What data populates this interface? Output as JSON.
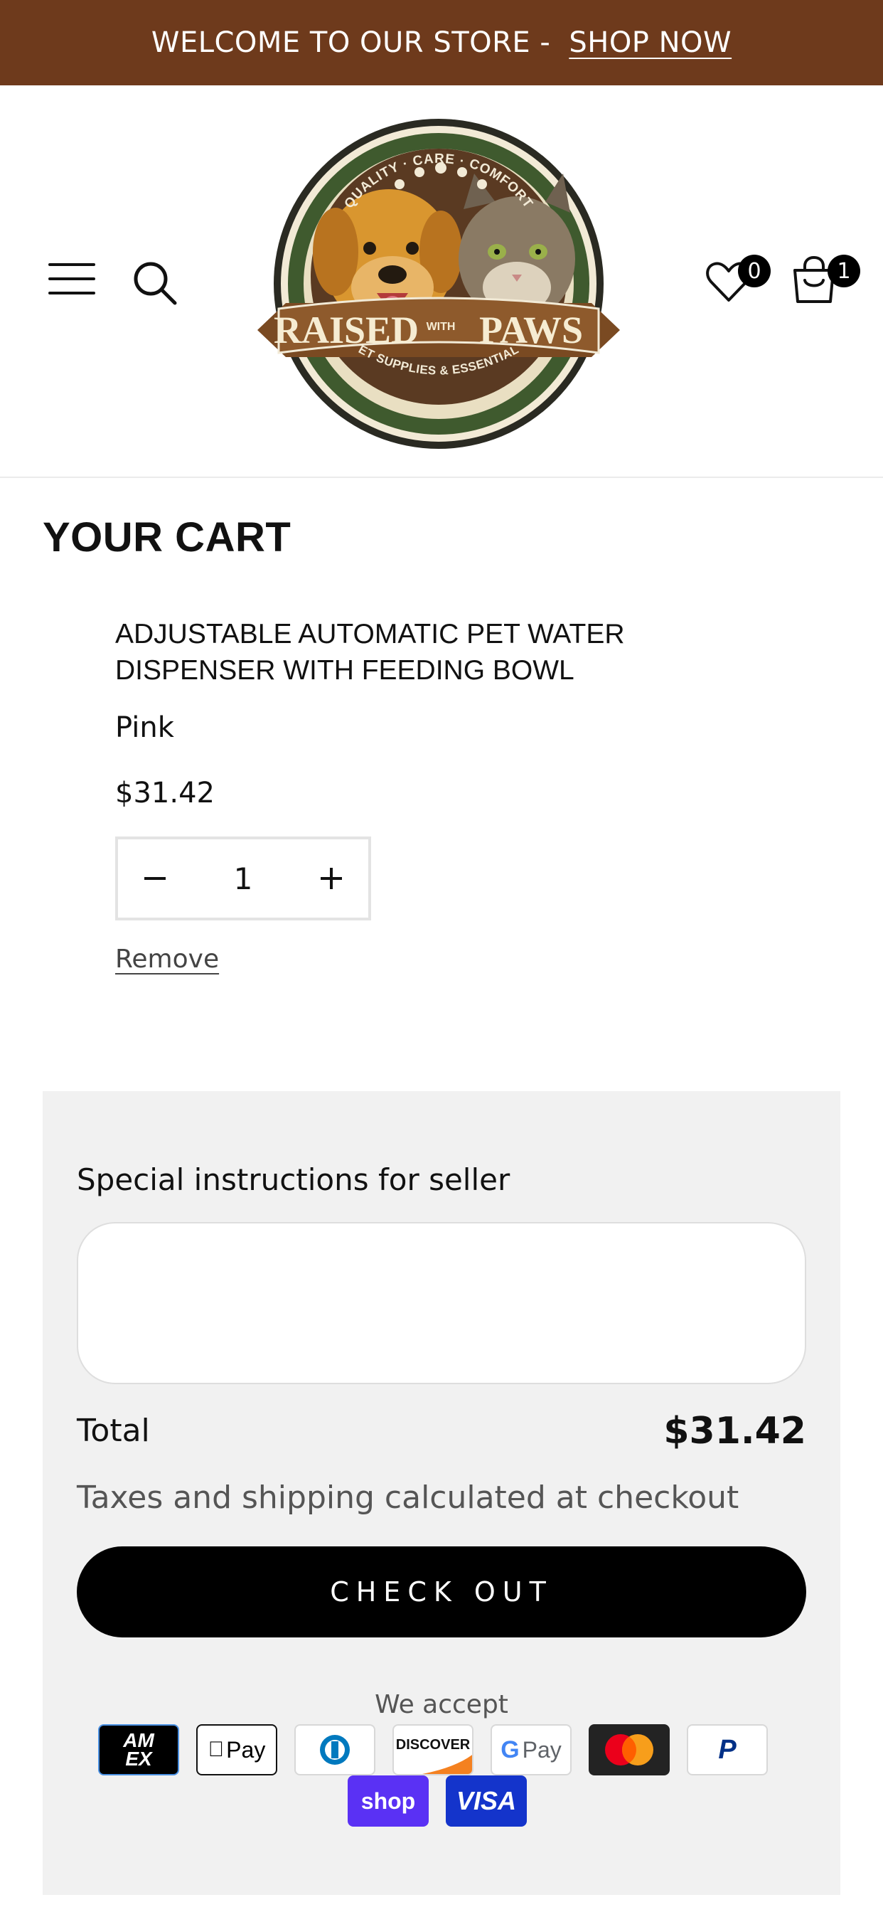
{
  "announcement": {
    "text": "WELCOME TO OUR STORE -",
    "link": "SHOP NOW"
  },
  "header": {
    "logo_text": {
      "top": "QUALITY · CARE · COMFORT",
      "brand_left": "RAISED",
      "brand_mid": "WITH",
      "brand_right": "PAWS",
      "bottom": "PET SUPPLIES & ESSENTIALS"
    },
    "wishlist_count": "0",
    "cart_count": "1"
  },
  "cart": {
    "title": "YOUR CART",
    "item": {
      "title": "ADJUSTABLE AUTOMATIC PET WATER DISPENSER WITH FEEDING BOWL",
      "variant": "Pink",
      "price": "$31.42",
      "quantity": "1",
      "remove_label": "Remove"
    }
  },
  "summary": {
    "instructions_label": "Special instructions for seller",
    "instructions_value": "",
    "total_label": "Total",
    "total_value": "$31.42",
    "tax_note": "Taxes and shipping calculated at checkout",
    "checkout_label": "CHECK OUT",
    "accept_label": "We accept",
    "payment_methods": [
      "American Express",
      "Apple Pay",
      "Diners Club",
      "Discover",
      "Google Pay",
      "Mastercard",
      "PayPal",
      "Shop Pay",
      "Visa"
    ],
    "payment_labels": {
      "amex_top": "AM",
      "amex_bottom": "EX",
      "applepay": "Pay",
      "discover": "DISCOVER",
      "gpay_g": "G",
      "gpay": "Pay",
      "paypal": "P",
      "shop": "shop",
      "visa": "VISA"
    }
  },
  "colors": {
    "announcement_bg": "#6e3a1c",
    "panel_bg": "#f1f1f1",
    "checkout_bg": "#000000"
  },
  "icons": [
    "hamburger-icon",
    "search-icon",
    "heart-icon",
    "cart-icon",
    "minus-icon",
    "plus-icon"
  ]
}
